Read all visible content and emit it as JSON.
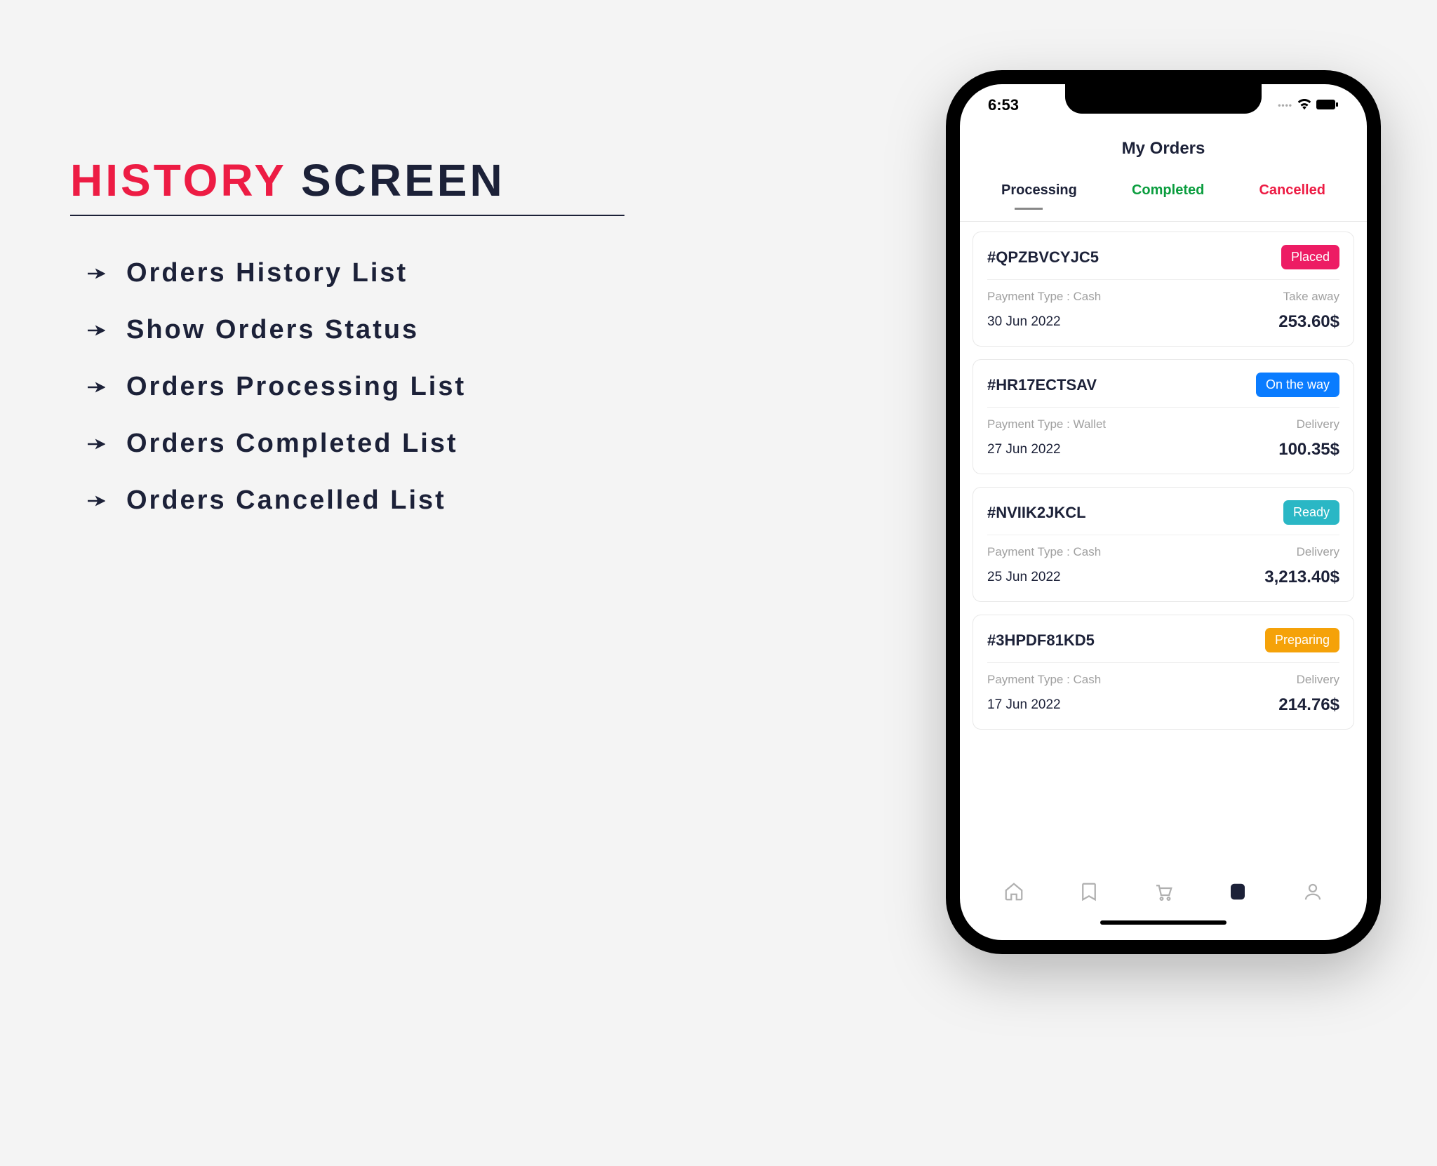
{
  "title": {
    "accent": "HISTORY",
    "main": "SCREEN"
  },
  "bullets": [
    "Orders History List",
    "Show Orders Status",
    "Orders Processing List",
    "Orders Completed List",
    "Orders Cancelled List"
  ],
  "phone": {
    "statusTime": "6:53",
    "screenTitle": "My Orders",
    "tabs": {
      "processing": "Processing",
      "completed": "Completed",
      "cancelled": "Cancelled"
    },
    "orders": [
      {
        "id": "#QPZBVCYJC5",
        "status": "Placed",
        "statusColor": "pink",
        "paymentLabel": "Payment Type :  Cash",
        "method": "Take away",
        "date": "30 Jun 2022",
        "price": "253.60$"
      },
      {
        "id": "#HR17ECTSAV",
        "status": "On the way",
        "statusColor": "blue",
        "paymentLabel": "Payment Type :  Wallet",
        "method": "Delivery",
        "date": "27 Jun 2022",
        "price": "100.35$"
      },
      {
        "id": "#NVIIK2JKCL",
        "status": "Ready",
        "statusColor": "teal",
        "paymentLabel": "Payment Type :  Cash",
        "method": "Delivery",
        "date": "25 Jun 2022",
        "price": "3,213.40$"
      },
      {
        "id": "#3HPDF81KD5",
        "status": "Preparing",
        "statusColor": "orange",
        "paymentLabel": "Payment Type :  Cash",
        "method": "Delivery",
        "date": "17 Jun 2022",
        "price": "214.76$"
      }
    ]
  }
}
